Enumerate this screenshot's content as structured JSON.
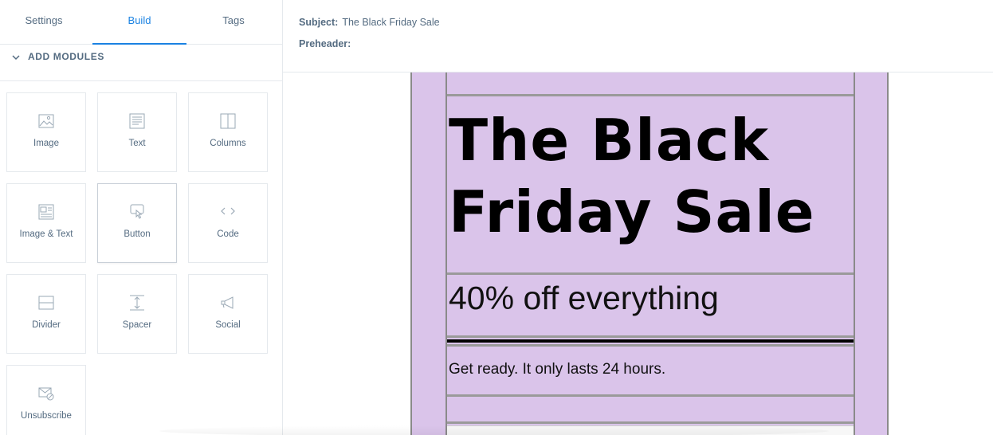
{
  "tabs": [
    {
      "label": "Settings",
      "active": false
    },
    {
      "label": "Build",
      "active": true
    },
    {
      "label": "Tags",
      "active": false
    }
  ],
  "section": {
    "title": "ADD MODULES",
    "icon": "chevron-down-icon"
  },
  "modules": [
    {
      "label": "Image",
      "icon": "image-icon"
    },
    {
      "label": "Text",
      "icon": "text-icon"
    },
    {
      "label": "Columns",
      "icon": "columns-icon"
    },
    {
      "label": "Image & Text",
      "icon": "image-text-icon"
    },
    {
      "label": "Button",
      "icon": "button-icon"
    },
    {
      "label": "Code",
      "icon": "code-icon"
    },
    {
      "label": "Divider",
      "icon": "divider-icon"
    },
    {
      "label": "Spacer",
      "icon": "spacer-icon"
    },
    {
      "label": "Social",
      "icon": "social-icon"
    },
    {
      "label": "Unsubscribe",
      "icon": "unsubscribe-icon"
    }
  ],
  "header": {
    "subject_label": "Subject:",
    "subject_value": "The Black Friday Sale",
    "preheader_label": "Preheader:",
    "preheader_value": ""
  },
  "email": {
    "background": "#dac4ea",
    "headline_line1": "The Black",
    "headline_line2": "Friday Sale",
    "subheadline": "40% off everything",
    "body": "Get ready. It only lasts 24 hours."
  },
  "colors": {
    "accent": "#1a82e2",
    "text": "#546b81",
    "border": "#e5e9ed"
  }
}
